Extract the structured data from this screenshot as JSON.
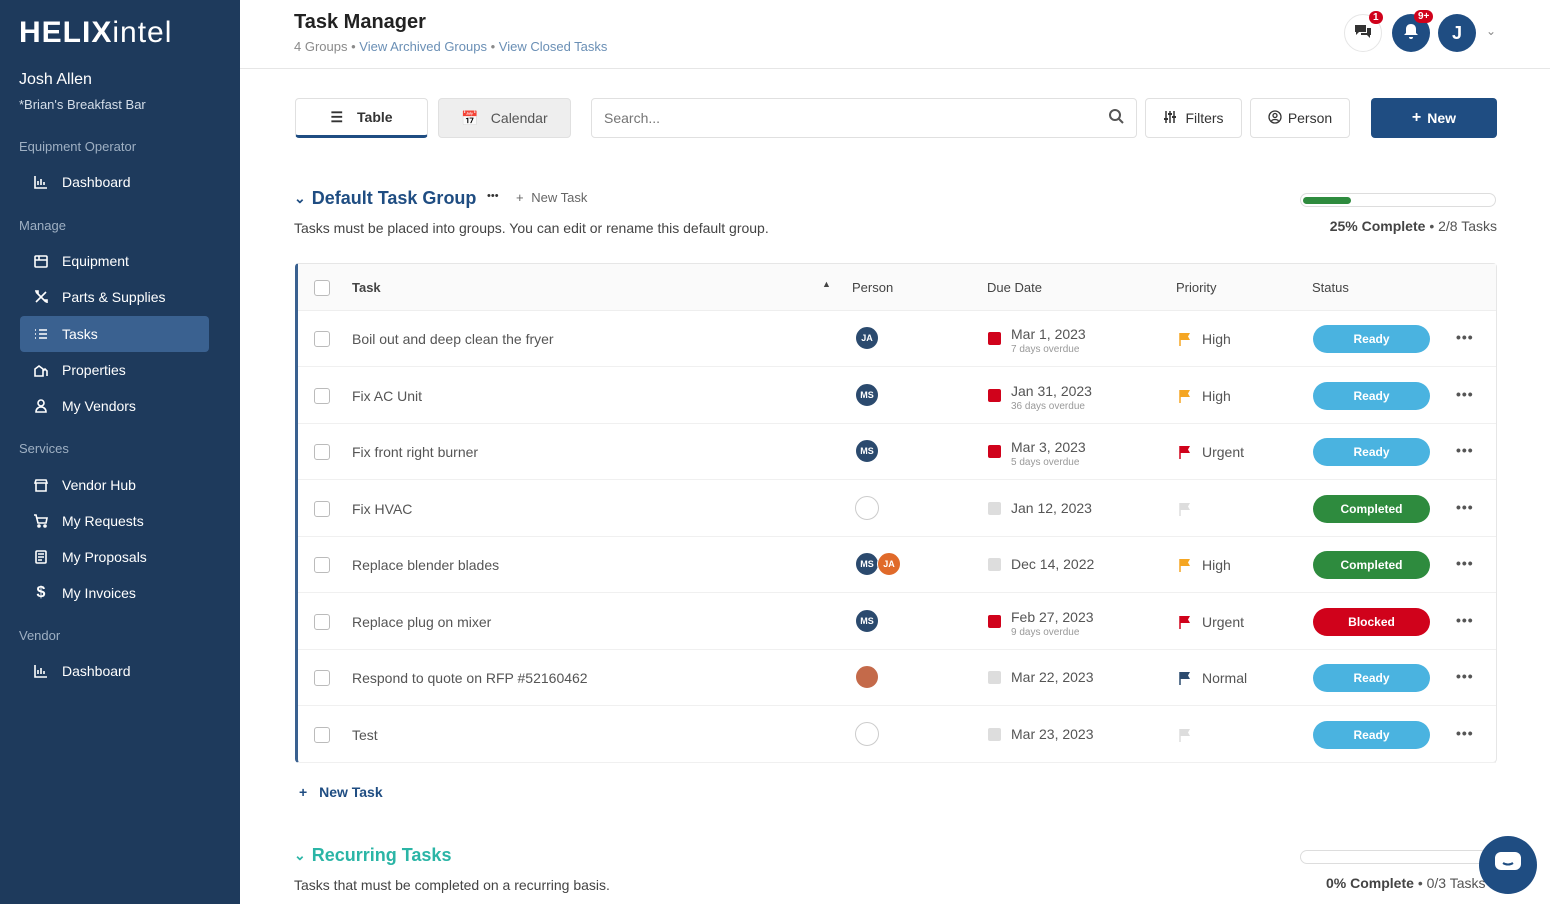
{
  "app": {
    "logo_bold": "HELIX",
    "logo_light": "intel"
  },
  "user": {
    "name": "Josh Allen",
    "org": "*Brian's Breakfast Bar",
    "initial": "J"
  },
  "sidebar": {
    "sections": [
      "Equipment Operator",
      "Manage",
      "Services",
      "Vendor"
    ],
    "items": [
      {
        "label": "Dashboard",
        "icon": "chart-icon"
      },
      {
        "label": "Equipment",
        "icon": "equipment-icon"
      },
      {
        "label": "Parts & Supplies",
        "icon": "tools-icon"
      },
      {
        "label": "Tasks",
        "icon": "tasks-icon"
      },
      {
        "label": "Properties",
        "icon": "properties-icon"
      },
      {
        "label": "My Vendors",
        "icon": "vendors-icon"
      },
      {
        "label": "Vendor Hub",
        "icon": "store-icon"
      },
      {
        "label": "My Requests",
        "icon": "cart-icon"
      },
      {
        "label": "My Proposals",
        "icon": "document-icon"
      },
      {
        "label": "My Invoices",
        "icon": "dollar-icon"
      },
      {
        "label": "Dashboard",
        "icon": "chart-icon"
      }
    ]
  },
  "header": {
    "title": "Task Manager",
    "groups_count": "4 Groups",
    "archived_link": "View Archived Groups",
    "closed_link": "View Closed Tasks",
    "separator": "•",
    "messages_badge": "1",
    "notifications_badge": "9+"
  },
  "toolbar": {
    "table_label": "Table",
    "calendar_label": "Calendar",
    "search_placeholder": "Search...",
    "filters_label": "Filters",
    "person_label": "Person",
    "new_label": "New"
  },
  "group": {
    "title": "Default Task Group",
    "more": "•••",
    "new_task": "New Task",
    "description": "Tasks must be placed into groups. You can edit or rename this default group.",
    "progress_percent": 25,
    "progress_label": "25% Complete",
    "progress_count": "2/8 Tasks",
    "columns": {
      "task": "Task",
      "person": "Person",
      "due": "Due Date",
      "priority": "Priority",
      "status": "Status"
    },
    "tasks": [
      {
        "name": "Boil out and deep clean the fryer",
        "people": [
          "JA"
        ],
        "date": "Mar 1, 2023",
        "overdue": "7 days overdue",
        "priority": "High",
        "status": "Ready"
      },
      {
        "name": "Fix AC Unit",
        "people": [
          "MS"
        ],
        "date": "Jan 31, 2023",
        "overdue": "36 days overdue",
        "priority": "High",
        "status": "Ready"
      },
      {
        "name": "Fix front right burner",
        "people": [
          "MS"
        ],
        "date": "Mar 3, 2023",
        "overdue": "5 days overdue",
        "priority": "Urgent",
        "status": "Ready"
      },
      {
        "name": "Fix HVAC",
        "people": [],
        "date": "Jan 12, 2023",
        "overdue": "",
        "priority": "",
        "status": "Completed"
      },
      {
        "name": "Replace blender blades",
        "people": [
          "MS",
          "JA"
        ],
        "date": "Dec 14, 2022",
        "overdue": "",
        "priority": "High",
        "status": "Completed"
      },
      {
        "name": "Replace plug on mixer",
        "people": [
          "MS"
        ],
        "date": "Feb 27, 2023",
        "overdue": "9 days overdue",
        "priority": "Urgent",
        "status": "Blocked"
      },
      {
        "name": "Respond to quote on RFP #52160462",
        "people": [
          "photo"
        ],
        "date": "Mar 22, 2023",
        "overdue": "",
        "priority": "Normal",
        "status": "Ready"
      },
      {
        "name": "Test",
        "people": [],
        "date": "Mar 23, 2023",
        "overdue": "",
        "priority": "",
        "status": "Ready"
      }
    ],
    "footer_new_task": "New Task"
  },
  "recurring": {
    "title": "Recurring Tasks",
    "description": "Tasks that must be completed on a recurring basis.",
    "progress_percent": 0,
    "progress_label": "0% Complete",
    "progress_count": "0/3 Tasks"
  },
  "colors": {
    "sidebar_bg": "#1e3a5c",
    "accent": "#1f4d82",
    "ready": "#4ab3e0",
    "completed": "#2e8b3e",
    "blocked": "#d0021b",
    "flag_high": "#f5a623",
    "flag_urgent": "#d0021b",
    "flag_normal": "#2b4a6e",
    "recurring_title": "#2bb5a6"
  }
}
